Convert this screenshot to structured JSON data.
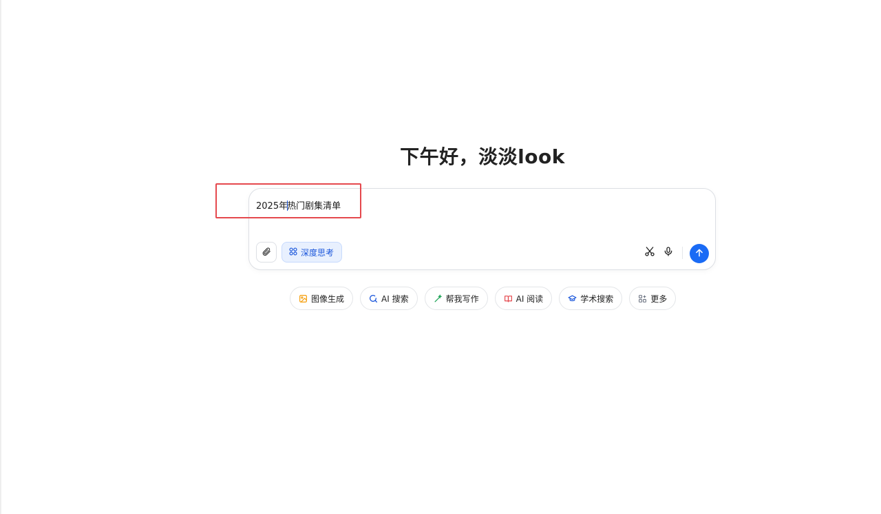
{
  "greeting": "下午好，淡淡look",
  "composer": {
    "text_before_caret": "2025年",
    "text_after_caret": "热门剧集清单",
    "deep_think_label": "深度思考"
  },
  "chips": [
    {
      "label": "图像生成",
      "icon": "image-gen-icon",
      "color": "#f59e0b"
    },
    {
      "label": "AI 搜索",
      "icon": "ai-search-icon",
      "color": "#1a56db"
    },
    {
      "label": "帮我写作",
      "icon": "write-icon",
      "color": "#22a55a"
    },
    {
      "label": "AI 阅读",
      "icon": "ai-read-icon",
      "color": "#e5484d"
    },
    {
      "label": "学术搜索",
      "icon": "academic-search-icon",
      "color": "#1a56db"
    },
    {
      "label": "更多",
      "icon": "more-grid-icon",
      "color": "#6b7280"
    }
  ],
  "colors": {
    "accent": "#1a6bf5",
    "highlight": "#e5484d"
  }
}
